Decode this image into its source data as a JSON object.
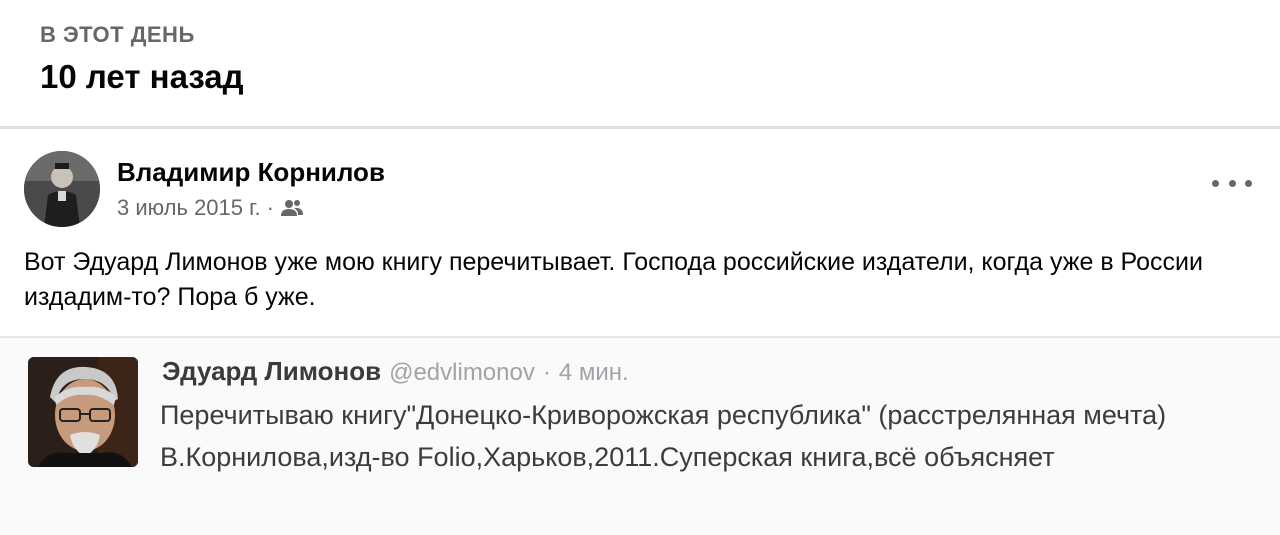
{
  "memory": {
    "label": "В ЭТОТ ДЕНЬ",
    "years_ago": "10 лет назад"
  },
  "post": {
    "author": "Владимир Корнилов",
    "date": "3 июль 2015 г.",
    "separator": "·",
    "audience_icon": "friends-icon",
    "more_icon": "more-options-icon",
    "text": "Вот Эдуард Лимонов уже мою книгу перечитывает. Господа российские издатели, когда уже в России издадим-то? Пора б уже."
  },
  "tweet": {
    "author": "Эдуард Лимонов",
    "handle": "@edvlimonov",
    "separator": "·",
    "time": "4 мин.",
    "text": "Перечитываю книгу\"Донецко-Криворожская республика\" (расстрелянная мечта) В.Корнилова,изд-во Folio,Харьков,2011.Суперская книга,всё объясняет"
  },
  "colors": {
    "secondary_text": "#65676b",
    "divider": "#dddfe2",
    "tweet_handle": "#a0a4a8"
  }
}
